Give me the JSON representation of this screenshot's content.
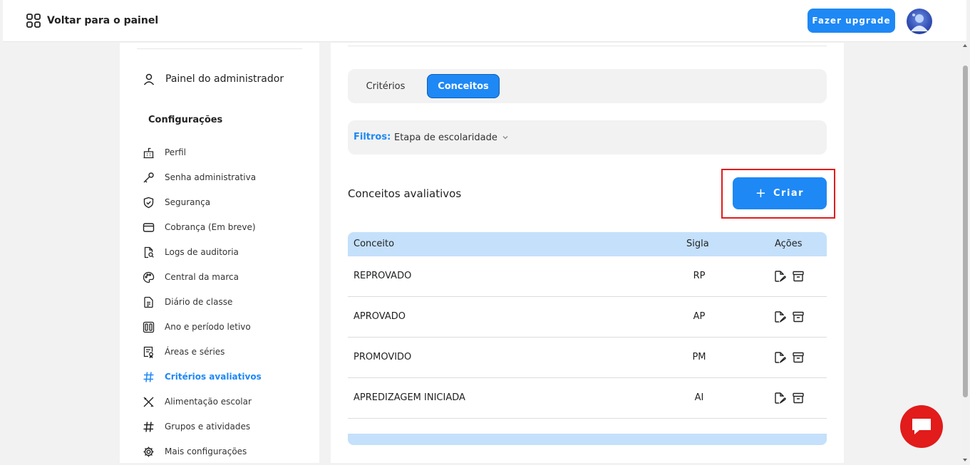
{
  "header": {
    "back_label": "Voltar para o painel",
    "upgrade_label": "Fazer upgrade",
    "avatar_icon": "user-avatar"
  },
  "sidebar": {
    "admin_label": "Painel do administrador",
    "section_title": "Configurações",
    "items": [
      {
        "label": "Perfil",
        "icon": "school-icon"
      },
      {
        "label": "Senha administrativa",
        "icon": "key-icon"
      },
      {
        "label": "Segurança",
        "icon": "shield-icon"
      },
      {
        "label": "Cobrança (Em breve)",
        "icon": "wallet-icon"
      },
      {
        "label": "Logs de auditoria",
        "icon": "document-search-icon"
      },
      {
        "label": "Central da marca",
        "icon": "palette-icon"
      },
      {
        "label": "Diário de classe",
        "icon": "document-icon"
      },
      {
        "label": "Ano e período letivo",
        "icon": "calendar-columns-icon"
      },
      {
        "label": "Áreas e séries",
        "icon": "certificate-icon"
      },
      {
        "label": "Critérios avaliativos",
        "icon": "hash-icon",
        "active": true
      },
      {
        "label": "Alimentação escolar",
        "icon": "utensils-icon"
      },
      {
        "label": "Grupos e atividades",
        "icon": "hash-icon"
      },
      {
        "label": "Mais configurações",
        "icon": "gear-icon"
      }
    ]
  },
  "main": {
    "tabs": [
      {
        "label": "Critérios"
      },
      {
        "label": "Conceitos",
        "active": true
      }
    ],
    "filters": {
      "label": "Filtros:",
      "select_label": "Etapa de escolaridade"
    },
    "section_title": "Conceitos avaliativos",
    "create_button": "Criar",
    "table": {
      "headers": [
        "Conceito",
        "Sigla",
        "Ações"
      ],
      "rows": [
        {
          "conceito": "REPROVADO",
          "sigla": "RP"
        },
        {
          "conceito": "APROVADO",
          "sigla": "AP"
        },
        {
          "conceito": "PROMOVIDO",
          "sigla": "PM"
        },
        {
          "conceito": "APREDIZAGEM INICIADA",
          "sigla": "AI"
        }
      ]
    }
  },
  "colors": {
    "accent": "#1e88f5",
    "table_header": "#c4e0fb",
    "highlight": "#e21b1b",
    "chat": "#e21b1b"
  }
}
